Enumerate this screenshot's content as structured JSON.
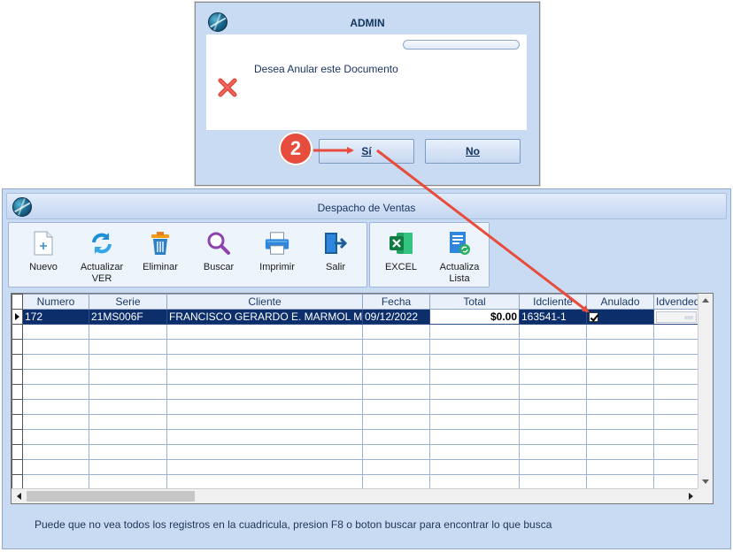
{
  "main_window": {
    "title": "Despacho de Ventas",
    "toolbar": [
      {
        "id": "nuevo",
        "label": "Nuevo",
        "icon": "new-document-icon"
      },
      {
        "id": "actualizar",
        "label": "Actualizar VER",
        "icon": "refresh-icon"
      },
      {
        "id": "eliminar",
        "label": "Eliminar",
        "icon": "trash-icon"
      },
      {
        "id": "buscar",
        "label": "Buscar",
        "icon": "magnifier-icon"
      },
      {
        "id": "imprimir",
        "label": "Imprimir",
        "icon": "printer-icon"
      },
      {
        "id": "salir",
        "label": "Salir",
        "icon": "exit-door-icon"
      }
    ],
    "toolbar2": [
      {
        "id": "excel",
        "label": "EXCEL",
        "icon": "excel-icon"
      },
      {
        "id": "actualiza-lista",
        "label": "Actualiza Lista",
        "icon": "refresh-list-icon"
      }
    ],
    "grid": {
      "columns": [
        "Numero",
        "Serie",
        "Cliente",
        "Fecha",
        "Total",
        "Idcliente",
        "Anulado",
        "Idvendedor"
      ],
      "rows": [
        {
          "numero": "172",
          "serie": "21MS006F",
          "cliente": "FRANCISCO GERARDO E. MARMOL MINA",
          "fecha": "09/12/2022",
          "total": "$0.00",
          "idcliente": "163541-1",
          "anulado": true,
          "idvendedor": ""
        }
      ],
      "empty_rows": 11
    },
    "status_message": "Puede que no vea todos los registros en la cuadricula, presion F8 o boton buscar para encontrar lo que busca"
  },
  "dialog": {
    "title": "ADMIN",
    "message": "Desea Anular este Documento",
    "icon": "error-x-icon",
    "yes_label": "Sí",
    "no_label": "No"
  },
  "annotation": {
    "step_number": "2",
    "color": "#e74c3c"
  },
  "colors": {
    "window_bg": "#c9dbf3",
    "selected_row": "#0c2f6b",
    "header_text": "#1b3a67"
  }
}
